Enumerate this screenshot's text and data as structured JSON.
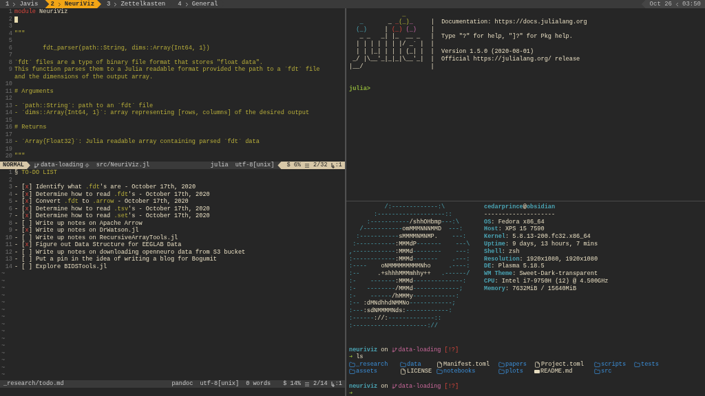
{
  "tmux": {
    "tabs": [
      {
        "index": "1",
        "name": "Javis",
        "selected": false
      },
      {
        "index": "2",
        "name": "NeuriViz",
        "selected": true
      },
      {
        "index": "3",
        "name": "Zettelkasten",
        "selected": false
      },
      {
        "index": "4",
        "name": "General",
        "selected": false
      }
    ],
    "date": "Oct 26",
    "time": "03:50"
  },
  "editor": {
    "lines": [
      {
        "number": "1",
        "segments": [
          {
            "text": "module",
            "kind": "keyword"
          },
          {
            "text": " NeuriViz",
            "kind": "plain"
          }
        ]
      },
      {
        "number": "2",
        "cursor": true
      },
      {
        "number": "3"
      },
      {
        "number": "4",
        "segments": [
          {
            "text": "\"\"\"",
            "kind": "doc"
          }
        ]
      },
      {
        "number": "5"
      },
      {
        "number": "6",
        "segments": [
          {
            "text": "        fdt_parser(path::String, dims::Array{Int64, 1})",
            "kind": "doc"
          }
        ]
      },
      {
        "number": "7"
      },
      {
        "number": "8",
        "segments": [
          {
            "text": "`fdt` files are a type of binary file format that stores \"float data\".",
            "kind": "doc"
          }
        ]
      },
      {
        "number": "9",
        "segments": [
          {
            "text": "This function parses them to a Julia readable format provided the path to a `fdt` file",
            "kind": "doc"
          }
        ]
      },
      {
        "segments": [
          {
            "text": "and the dimensions of the output array.",
            "kind": "doc"
          }
        ]
      },
      {
        "number": "10"
      },
      {
        "number": "11",
        "segments": [
          {
            "text": "# Arguments",
            "kind": "doc"
          }
        ]
      },
      {
        "number": "12"
      },
      {
        "number": "13",
        "segments": [
          {
            "text": "- `path::String`: path to an `fdt` file",
            "kind": "doc"
          }
        ]
      },
      {
        "number": "14",
        "segments": [
          {
            "text": "- `dims::Array{Int64, 1}`: array representing [rows, columns] of the desired output",
            "kind": "doc"
          }
        ]
      },
      {
        "number": "15"
      },
      {
        "number": "16",
        "segments": [
          {
            "text": "# Returns",
            "kind": "doc"
          }
        ]
      },
      {
        "number": "17"
      },
      {
        "number": "18",
        "segments": [
          {
            "text": "- `Array{Float32}`: Julia readable array containing parsed `fdt` data",
            "kind": "doc"
          }
        ]
      },
      {
        "number": "19"
      },
      {
        "number": "20",
        "segments": [
          {
            "text": "\"\"\"",
            "kind": "doc"
          }
        ]
      }
    ],
    "status": {
      "mode": "NORMAL",
      "branch": "data-loading",
      "file": "src/NeuriViz.jl",
      "filetype": "julia",
      "encoding": "utf-8[unix]",
      "percent": "$ 6%",
      "position": "2/32",
      "column": ":1"
    }
  },
  "todo": {
    "lines": [
      {
        "number": "1",
        "segments": [
          {
            "text": "§ ",
            "kind": "plain"
          },
          {
            "text": "TO-DO LIST",
            "kind": "doc"
          }
        ]
      },
      {
        "number": "2"
      },
      {
        "number": "3",
        "segments": [
          {
            "text": "- [",
            "kind": "plain"
          },
          {
            "text": "x",
            "kind": "check"
          },
          {
            "text": "] Identify what ",
            "kind": "plain"
          },
          {
            "text": ".fdt",
            "kind": "doc"
          },
          {
            "text": "'s are - October 17th, 2020",
            "kind": "plain"
          }
        ]
      },
      {
        "number": "4",
        "segments": [
          {
            "text": "- [",
            "kind": "plain"
          },
          {
            "text": "x",
            "kind": "check"
          },
          {
            "text": "] Determine how to read ",
            "kind": "plain"
          },
          {
            "text": ".fdt",
            "kind": "doc"
          },
          {
            "text": "'s - October 17th, 2020",
            "kind": "plain"
          }
        ]
      },
      {
        "number": "5",
        "segments": [
          {
            "text": "- [",
            "kind": "plain"
          },
          {
            "text": "x",
            "kind": "check"
          },
          {
            "text": "] Convert ",
            "kind": "plain"
          },
          {
            "text": ".fdt",
            "kind": "doc"
          },
          {
            "text": " to ",
            "kind": "plain"
          },
          {
            "text": ".arrow",
            "kind": "doc"
          },
          {
            "text": " - October 17th, 2020",
            "kind": "plain"
          }
        ]
      },
      {
        "number": "6",
        "segments": [
          {
            "text": "- [",
            "kind": "plain"
          },
          {
            "text": "x",
            "kind": "check"
          },
          {
            "text": "] Determine how to read ",
            "kind": "plain"
          },
          {
            "text": ".tsv",
            "kind": "doc"
          },
          {
            "text": "'s - October 17th, 2020",
            "kind": "plain"
          }
        ]
      },
      {
        "number": "7",
        "segments": [
          {
            "text": "- [",
            "kind": "plain"
          },
          {
            "text": "x",
            "kind": "check"
          },
          {
            "text": "] Determine how to read ",
            "kind": "plain"
          },
          {
            "text": ".set",
            "kind": "doc"
          },
          {
            "text": "'s - October 17th, 2020",
            "kind": "plain"
          }
        ]
      },
      {
        "number": "8",
        "segments": [
          {
            "text": "- [ ] Write up notes on Apache Arrow",
            "kind": "plain"
          }
        ]
      },
      {
        "number": "9",
        "segments": [
          {
            "text": "- [",
            "kind": "plain"
          },
          {
            "text": "x",
            "kind": "check"
          },
          {
            "text": "] Write up notes on DrWatson.jl",
            "kind": "plain"
          }
        ]
      },
      {
        "number": "10",
        "segments": [
          {
            "text": "- [ ] Write up notes on RecursiveArrayTools.jl",
            "kind": "plain"
          }
        ]
      },
      {
        "number": "11",
        "segments": [
          {
            "text": "- [",
            "kind": "plain"
          },
          {
            "text": "x",
            "kind": "check"
          },
          {
            "text": "] Figure out Data Structure for EEGLAB Data",
            "kind": "plain"
          }
        ]
      },
      {
        "number": "12",
        "segments": [
          {
            "text": "- [ ] Write up notes on downloading openneuro data from S3 bucket",
            "kind": "plain"
          }
        ]
      },
      {
        "number": "13",
        "segments": [
          {
            "text": "- [ ] Put a pin in the idea of writing a blog for Bogumit",
            "kind": "plain"
          }
        ]
      },
      {
        "number": "14",
        "segments": [
          {
            "text": "- [ ] Explore BIDSTools.jl",
            "kind": "plain"
          }
        ]
      }
    ],
    "filler": [
      "~",
      "~",
      "~",
      "~",
      "~",
      "~",
      "~",
      "~",
      "~",
      "~",
      "~",
      "~",
      "~",
      "~",
      "~"
    ],
    "status": {
      "file": "_research/todo.md",
      "filetype": "pandoc",
      "encoding": "utf-8[unix]",
      "words": "0 words",
      "percent": "$ 14%",
      "position": "2/14",
      "column": ":1"
    }
  },
  "julia": {
    "banner": [
      [
        {
          "text": "               _",
          "kind": "circle_green"
        }
      ],
      [
        {
          "text": "   _",
          "kind": "circle_blue"
        },
        {
          "text": "       _ ",
          "kind": "text"
        },
        {
          "text": "_",
          "kind": "circle_red"
        },
        {
          "text": "(_)",
          "kind": "circle_green"
        },
        {
          "text": "_",
          "kind": "circle_purple"
        },
        {
          "text": "     |  Documentation: https://docs.julialang.org",
          "kind": "text"
        }
      ],
      [
        {
          "text": "  (_)",
          "kind": "circle_blue"
        },
        {
          "text": "     | ",
          "kind": "text"
        },
        {
          "text": "(_)",
          "kind": "circle_red"
        },
        {
          "text": " (_)",
          "kind": "circle_purple"
        },
        {
          "text": "    |",
          "kind": "text"
        }
      ],
      [
        {
          "text": "   _ _   _| |_  __ _   |  Type \"?\" for help, \"]?\" for Pkg help.",
          "kind": "text"
        }
      ],
      [
        {
          "text": "  | | | | | | |/ _` |  |",
          "kind": "text"
        }
      ],
      [
        {
          "text": "  | | |_| | | | (_| |  |  Version 1.5.0 (2020-08-01)",
          "kind": "text"
        }
      ],
      [
        {
          "text": " _/ |\\__'_|_|_|\\__'_|  |  Official https://julialang.org/ release",
          "kind": "text"
        }
      ],
      [
        {
          "text": "|__/                   |",
          "kind": "text"
        }
      ]
    ],
    "prompt": "julia>"
  },
  "neofetch": {
    "logo": [
      [
        {
          "text": "          /:-------------:\\",
          "kind": "accent"
        }
      ],
      [
        {
          "text": "       :-------------------::",
          "kind": "accent"
        }
      ],
      [
        {
          "text": "     :-----------",
          "kind": "accent"
        },
        {
          "text": "/shhOHbmp",
          "kind": "bright"
        },
        {
          "text": "---:\\",
          "kind": "accent"
        }
      ],
      [
        {
          "text": "   /-----------",
          "kind": "accent"
        },
        {
          "text": "omMMMNNNMMD",
          "kind": "bright"
        },
        {
          "text": "  ---:",
          "kind": "accent"
        }
      ],
      [
        {
          "text": "  :-----------",
          "kind": "accent"
        },
        {
          "text": "sMMMMNMNMP.",
          "kind": "bright"
        },
        {
          "text": "    ---:",
          "kind": "accent"
        }
      ],
      [
        {
          "text": " :-----------",
          "kind": "accent"
        },
        {
          "text": ":MMMdP",
          "kind": "bright"
        },
        {
          "text": "-------    ---\\",
          "kind": "accent"
        }
      ],
      [
        {
          "text": ",------------",
          "kind": "accent"
        },
        {
          "text": ":MMMd",
          "kind": "bright"
        },
        {
          "text": "--------    ---:",
          "kind": "accent"
        }
      ],
      [
        {
          "text": ":------------",
          "kind": "accent"
        },
        {
          "text": ":MMMd",
          "kind": "bright"
        },
        {
          "text": "-------    .---:",
          "kind": "accent"
        }
      ],
      [
        {
          "text": ":----    ",
          "kind": "accent"
        },
        {
          "text": "oNMMMMMMMMMNho",
          "kind": "bright"
        },
        {
          "text": "     .----:",
          "kind": "accent"
        }
      ],
      [
        {
          "text": ":--     ",
          "kind": "accent"
        },
        {
          "text": ".+shhhMMMmhhy++",
          "kind": "bright"
        },
        {
          "text": "   .------/",
          "kind": "accent"
        }
      ],
      [
        {
          "text": ":-    -------",
          "kind": "accent"
        },
        {
          "text": ":MMMd",
          "kind": "bright"
        },
        {
          "text": "--------------:",
          "kind": "accent"
        }
      ],
      [
        {
          "text": ":-   --------",
          "kind": "accent"
        },
        {
          "text": "/MMMd",
          "kind": "bright"
        },
        {
          "text": "-------------;",
          "kind": "accent"
        }
      ],
      [
        {
          "text": ":-    ------",
          "kind": "accent"
        },
        {
          "text": "/hMMMy",
          "kind": "bright"
        },
        {
          "text": "------------:",
          "kind": "accent"
        }
      ],
      [
        {
          "text": ":-- ",
          "kind": "accent"
        },
        {
          "text": ":dMNdhhdNMMNo",
          "kind": "bright"
        },
        {
          "text": "------------;",
          "kind": "accent"
        }
      ],
      [
        {
          "text": ":---",
          "kind": "accent"
        },
        {
          "text": ":sdNMMMMNds:",
          "kind": "bright"
        },
        {
          "text": "------------:",
          "kind": "accent"
        }
      ],
      [
        {
          "text": ":------",
          "kind": "accent"
        },
        {
          "text": "://:",
          "kind": "bright"
        },
        {
          "text": "-------------::",
          "kind": "accent"
        }
      ],
      [
        {
          "text": ":---------------------://",
          "kind": "accent"
        }
      ]
    ],
    "user": [
      {
        "text": "cedarprince",
        "kind": "accent"
      },
      {
        "text": "@",
        "kind": "bright"
      },
      {
        "text": "obsidian",
        "kind": "accent"
      }
    ],
    "rule": "--------------------",
    "info": [
      {
        "label": "OS",
        "value": ": Fedora x86_64"
      },
      {
        "label": "Host",
        "value": ": XPS 15 7590"
      },
      {
        "label": "Kernel",
        "value": ": 5.8.13-200.fc32.x86_64"
      },
      {
        "label": "Uptime",
        "value": ": 9 days, 13 hours, 7 mins"
      },
      {
        "label": "Shell",
        "value": ": zsh"
      },
      {
        "label": "Resolution",
        "value": ": 1920x1080, 1920x1080"
      },
      {
        "label": "DE",
        "value": ": Plasma 5.18.5"
      },
      {
        "label": "WM Theme",
        "value": ": Sweet-Dark-transparent"
      },
      {
        "label": "CPU",
        "value": ": Intel i7-9750H (12) @ 4.500GHz"
      },
      {
        "label": "Memory",
        "value": ": 7632MiB / 15640MiB"
      }
    ]
  },
  "shell": {
    "sessions": [
      {
        "dir": "neuriviz",
        "on": "on",
        "branch": "data-loading",
        "git_status": "[!?]",
        "arrow": "➜",
        "command": "ls",
        "listing": [
          {
            "name": "_research",
            "kind": "dir"
          },
          {
            "name": "data",
            "kind": "dir"
          },
          {
            "name": "Manifest.toml",
            "kind": "file"
          },
          {
            "name": "papers",
            "kind": "dir"
          },
          {
            "name": "Project.toml",
            "kind": "file"
          },
          {
            "name": "scripts",
            "kind": "dir"
          },
          {
            "name": "tests",
            "kind": "dir"
          },
          {
            "name": "assets",
            "kind": "dir"
          },
          {
            "name": "LICENSE",
            "kind": "file"
          },
          {
            "name": "notebooks",
            "kind": "dir"
          },
          {
            "name": "plots",
            "kind": "dir"
          },
          {
            "name": "README.md",
            "kind": "doc"
          },
          {
            "name": "src",
            "kind": "dir"
          }
        ]
      },
      {
        "dir": "neuriviz",
        "on": "on",
        "branch": "data-loading",
        "git_status": "[!?]",
        "arrow": "➜"
      }
    ]
  }
}
